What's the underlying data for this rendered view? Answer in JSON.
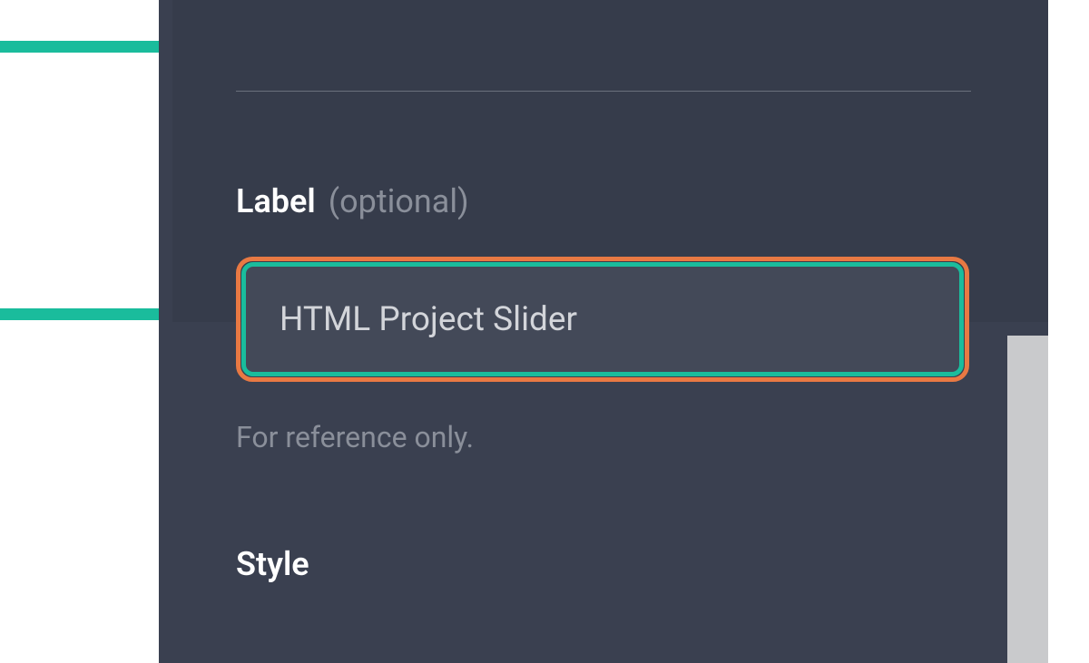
{
  "form": {
    "label": {
      "title": "Label",
      "hint": "(optional)",
      "value": "HTML Project Slider",
      "help": "For reference only."
    },
    "style": {
      "title": "Style"
    }
  },
  "colors": {
    "accent_teal": "#1abc9c",
    "highlight_orange": "#e87943",
    "panel_bg": "#3a4050",
    "panel_inner": "#363c4b",
    "input_bg": "#434958"
  }
}
